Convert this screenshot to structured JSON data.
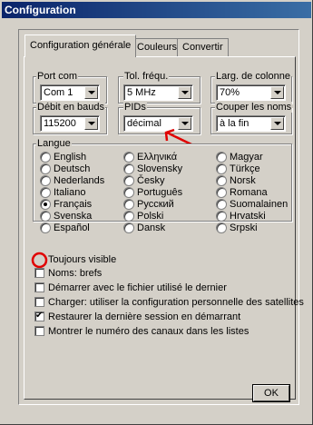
{
  "window": {
    "title": "Configuration"
  },
  "tabs": [
    "Configuration générale",
    "Couleurs",
    "Convertir"
  ],
  "groups": {
    "port_com": {
      "label": "Port com",
      "value": "Com 1"
    },
    "tol_frequ": {
      "label": "Tol. fréqu.",
      "value": "5 MHz"
    },
    "larg_colonne": {
      "label": "Larg. de colonne",
      "value": "70%"
    },
    "debit": {
      "label": "Débit en bauds",
      "value": "115200"
    },
    "pids": {
      "label": "PIDs",
      "value": "décimal"
    },
    "couper": {
      "label": "Couper les noms",
      "value": "à la fin"
    }
  },
  "langue": {
    "label": "Langue",
    "options": [
      "English",
      "Deutsch",
      "Nederlands",
      "Italiano",
      "Français",
      "Svenska",
      "Español",
      "Ελληνικά",
      "Slovensky",
      "Česky",
      "Português",
      "Русский",
      "Polski",
      "Dansk",
      "Magyar",
      "Türkçe",
      "Norsk",
      "Romana",
      "Suomalainen",
      "Hrvatski",
      "Srpski"
    ],
    "selected": "Français"
  },
  "options": [
    {
      "label": "Toujours visible",
      "checked": false
    },
    {
      "label": "Noms: brefs",
      "checked": false
    },
    {
      "label": "Démarrer avec le fichier utilisé le dernier",
      "checked": false
    },
    {
      "label": "Charger: utiliser la configuration personnelle des satellites",
      "checked": false
    },
    {
      "label": "Restaurer la dernière session en démarrant",
      "checked": true
    },
    {
      "label": "Montrer le numéro des canaux dans les listes",
      "checked": false
    }
  ],
  "buttons": {
    "ok": "OK"
  },
  "annotations": {
    "circle_color": "#e00000",
    "arrow_color": "#e00000"
  }
}
